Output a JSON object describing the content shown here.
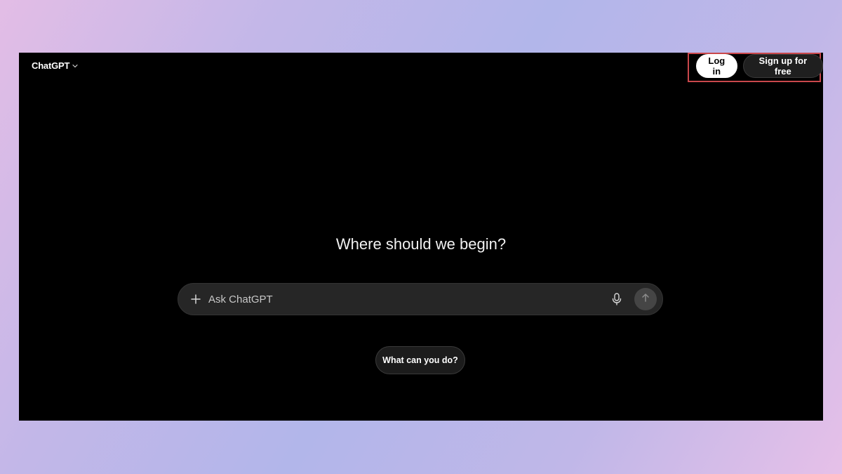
{
  "header": {
    "brand": "ChatGPT",
    "login_label": "Log in",
    "signup_label": "Sign up for free"
  },
  "main": {
    "heading": "Where should we begin?",
    "composer": {
      "placeholder": "Ask ChatGPT",
      "icons": [
        "plus-icon",
        "microphone-icon",
        "arrow-up-icon"
      ]
    },
    "suggestion": "What can you do?"
  },
  "colors": {
    "app_background": "#000000",
    "composer_background": "#262626",
    "highlight_border": "#c9474b",
    "login_background": "#ffffff"
  }
}
